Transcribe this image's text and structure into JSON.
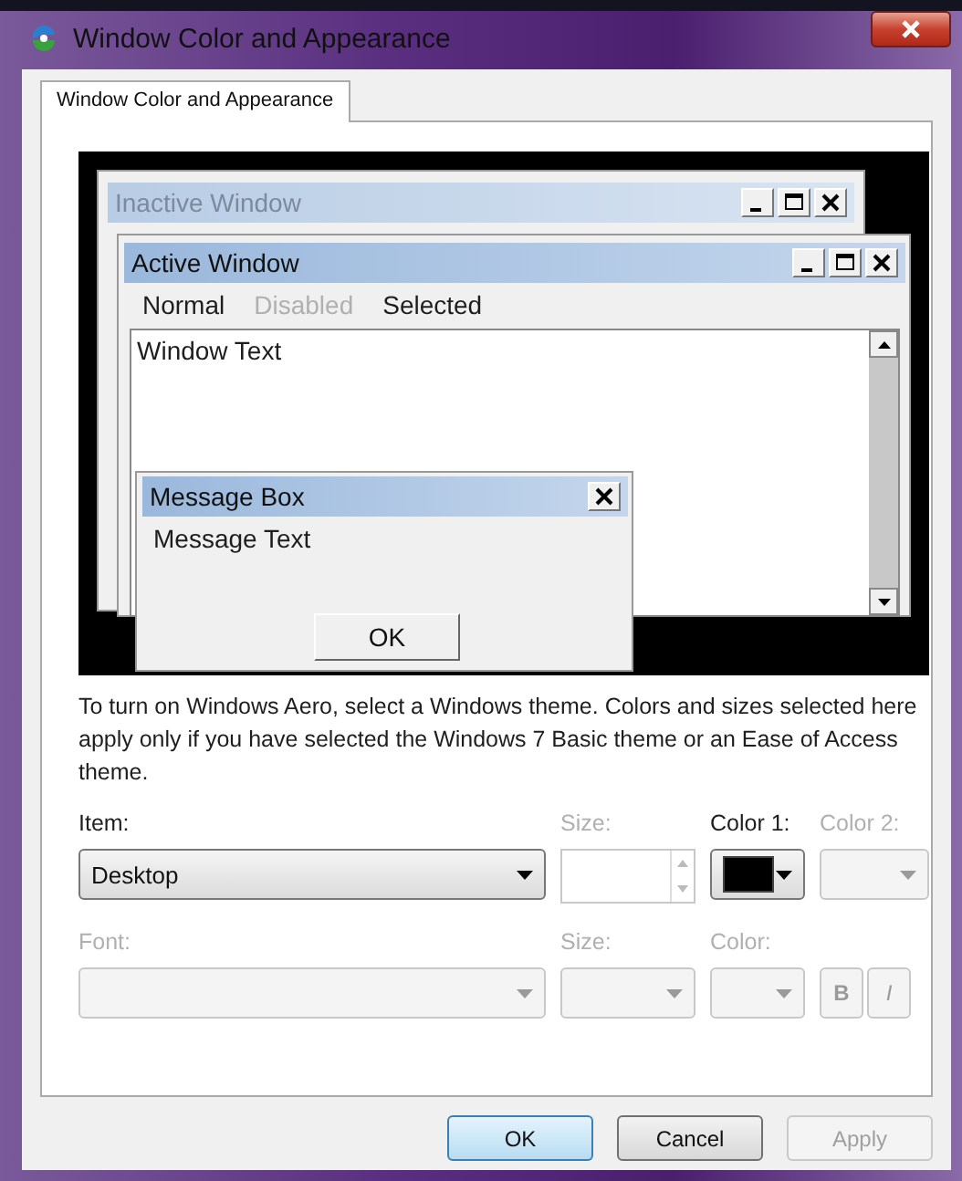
{
  "window": {
    "title": "Window Color and Appearance"
  },
  "tabs": [
    {
      "label": "Window Color and Appearance",
      "selected": true
    }
  ],
  "preview": {
    "inactive_window": {
      "title": "Inactive Window"
    },
    "active_window": {
      "title": "Active Window",
      "menu": [
        {
          "label": "Normal",
          "disabled": false
        },
        {
          "label": "Disabled",
          "disabled": true
        },
        {
          "label": "Selected",
          "disabled": false
        }
      ],
      "text": "Window Text"
    },
    "message_box": {
      "title": "Message Box",
      "text": "Message Text",
      "button": "OK"
    }
  },
  "note": "To turn on Windows Aero, select a Windows theme.  Colors and sizes selected here apply only if you have selected the Windows 7 Basic theme or an Ease of Access theme.",
  "item": {
    "label": "Item:",
    "value": "Desktop"
  },
  "item_size": {
    "label": "Size:",
    "disabled": true
  },
  "color_1": {
    "label": "Color 1:",
    "disabled": false,
    "color": "#000000"
  },
  "color_2": {
    "label": "Color 2:",
    "disabled": true
  },
  "font": {
    "label": "Font:",
    "disabled": true
  },
  "font_size": {
    "label": "Size:",
    "disabled": true
  },
  "font_color": {
    "label": "Color:",
    "disabled": true
  },
  "bold": {
    "label": "B",
    "disabled": true
  },
  "italic": {
    "label": "I",
    "disabled": true
  },
  "buttons": [
    {
      "label": "OK",
      "kind": "default"
    },
    {
      "label": "Cancel",
      "kind": "normal"
    },
    {
      "label": "Apply",
      "kind": "disabled"
    }
  ]
}
